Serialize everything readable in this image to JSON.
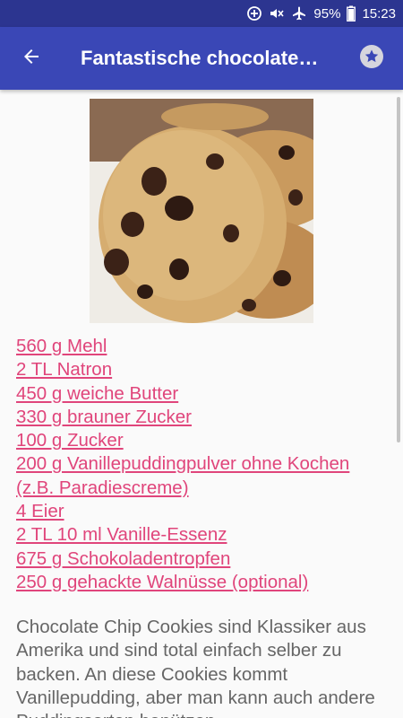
{
  "status_bar": {
    "battery": "95%",
    "time": "15:23"
  },
  "app_bar": {
    "title": "Fantastische chocolate chip cookies"
  },
  "recipe": {
    "image_alt": "Chocolate chip cookies",
    "ingredients": [
      "560 g Mehl",
      "2 TL Natron",
      "450 g weiche Butter",
      "330 g brauner Zucker",
      "100 g Zucker",
      "200 g Vanillepuddingpulver ohne Kochen (z.B. Paradiescreme)",
      "4 Eier",
      "2 TL 10 ml Vanille-Essenz",
      "675 g Schokoladentropfen",
      "250 g gehackte Walnüsse (optional)"
    ],
    "description": "Chocolate Chip Cookies sind Klassiker aus Amerika und sind total einfach selber zu backen. An diese Cookies kommt Vanillepudding, aber man kann auch andere Puddingsorten benützen"
  },
  "colors": {
    "status_bar": "#2c3590",
    "app_bar": "#3a47b6",
    "link": "#e0457b",
    "text": "#666666"
  },
  "icons": {
    "back": "arrow-left-icon",
    "favorite": "star-icon"
  }
}
